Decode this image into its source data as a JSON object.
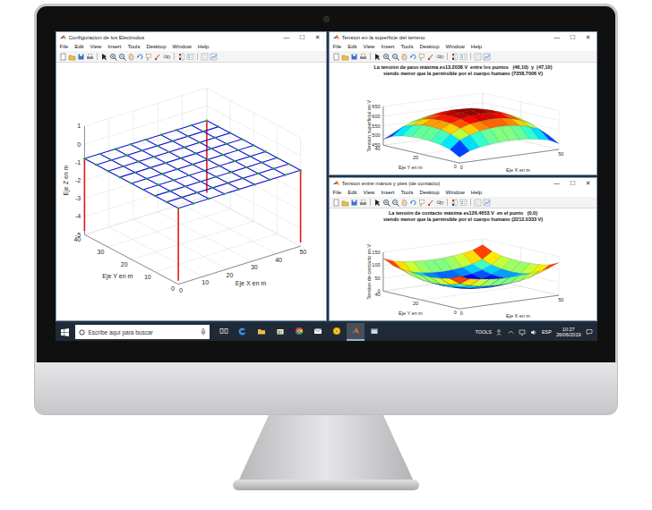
{
  "window_controls": [
    "—",
    "☐",
    "✕"
  ],
  "menu": [
    "File",
    "Edit",
    "View",
    "Insert",
    "Tools",
    "Desktop",
    "Window",
    "Help"
  ],
  "electrode_figure": {
    "window_title": "Configuracion de los Electrodos",
    "x_label": "Eje X en m",
    "y_label": "Eje Y en m",
    "z_label": "Eje Z en m",
    "x_ticks": [
      "0",
      "10",
      "20",
      "30",
      "40",
      "50"
    ],
    "y_ticks": [
      "0",
      "10",
      "20",
      "30",
      "40"
    ],
    "z_ticks": [
      "-5",
      "-4",
      "-3",
      "-2",
      "-1",
      "0",
      "1"
    ],
    "grid_x": [
      0,
      6.25,
      12.5,
      18.75,
      25,
      31.25,
      37.5,
      43.75,
      50
    ],
    "grid_y": [
      0,
      5,
      10,
      15,
      20,
      25,
      30,
      35,
      40
    ],
    "grid_depth": -0.8,
    "rods": [
      {
        "x": 0,
        "y": 0,
        "bottom": -4.8
      },
      {
        "x": 50,
        "y": 0,
        "bottom": -4.8
      },
      {
        "x": 0,
        "y": 40,
        "bottom": -4.8
      },
      {
        "x": 50,
        "y": 40,
        "bottom": -4.8
      }
    ]
  },
  "surface_figure": {
    "window_title": "Tension en la superficie del terreno",
    "title_lines": [
      "La tensión de paso máxima es13.2038 V  entre los puntos   (46,10)  y  (47,10)",
      "siendo menor que la permisible por el cuerpo humano (7358.7006 V)"
    ],
    "x_label": "Eje X en m",
    "y_label": "Eje Y en m",
    "z_label": "Tension superficial en V",
    "x_ticks": [
      "0",
      "50"
    ],
    "y_ticks": [
      "0",
      "20",
      "40"
    ],
    "z_ticks": [
      "450",
      "500",
      "550",
      "600",
      "650"
    ],
    "x_values": [
      0,
      5,
      10,
      15,
      20,
      25,
      30,
      35,
      40,
      45,
      50
    ],
    "y_values": [
      0,
      5,
      10,
      15,
      20,
      25,
      30,
      35,
      40
    ],
    "values": [
      [
        480,
        505,
        516,
        524,
        529,
        530,
        529,
        524,
        516,
        505,
        480
      ],
      [
        508,
        549,
        569,
        582,
        589,
        592,
        589,
        582,
        569,
        549,
        508
      ],
      [
        521,
        569,
        592,
        608,
        616,
        619,
        616,
        608,
        592,
        569,
        521
      ],
      [
        528,
        581,
        606,
        622,
        632,
        635,
        632,
        622,
        606,
        581,
        528
      ],
      [
        530,
        584,
        610,
        627,
        637,
        640,
        637,
        627,
        610,
        584,
        530
      ],
      [
        528,
        581,
        606,
        622,
        632,
        635,
        632,
        622,
        606,
        581,
        528
      ],
      [
        521,
        569,
        592,
        608,
        616,
        619,
        616,
        608,
        592,
        569,
        521
      ],
      [
        508,
        549,
        569,
        582,
        589,
        592,
        589,
        582,
        569,
        549,
        508
      ],
      [
        480,
        505,
        516,
        524,
        529,
        530,
        529,
        524,
        516,
        505,
        480
      ]
    ]
  },
  "contact_figure": {
    "window_title": "Tension entre manos y pies (de contacto)",
    "title_lines": [
      "La tensión de contacto máxima es126.4653 V  en el punto   (0,0)",
      "siendo menor que la permisible por el cuerpo humano (2212.0333 V)"
    ],
    "x_label": "Eje X en m",
    "y_label": "Eje Y en m",
    "z_label": "Tension de contacto en V",
    "x_ticks": [
      "0",
      "50"
    ],
    "y_ticks": [
      "0",
      "20",
      "40"
    ],
    "z_ticks": [
      "0",
      "50",
      "100",
      "150"
    ],
    "x_values": [
      0,
      5,
      10,
      15,
      20,
      25,
      30,
      35,
      40,
      45,
      50
    ],
    "y_values": [
      0,
      5,
      10,
      15,
      20,
      25,
      30,
      35,
      40
    ],
    "values": [
      [
        126.5,
        111,
        104,
        99,
        96,
        95,
        96,
        99,
        104,
        111,
        126.5
      ],
      [
        109,
        84,
        71,
        63,
        59,
        57,
        59,
        63,
        71,
        84,
        109
      ],
      [
        101,
        71,
        57,
        47,
        42,
        40,
        42,
        47,
        57,
        71,
        101
      ],
      [
        97,
        64,
        48,
        38,
        32,
        30,
        32,
        38,
        48,
        64,
        97
      ],
      [
        95,
        62,
        46,
        35,
        29,
        27,
        29,
        35,
        46,
        62,
        95
      ],
      [
        97,
        64,
        48,
        38,
        32,
        30,
        32,
        38,
        48,
        64,
        97
      ],
      [
        101,
        71,
        57,
        47,
        42,
        40,
        42,
        47,
        57,
        71,
        101
      ],
      [
        109,
        84,
        71,
        63,
        59,
        57,
        59,
        63,
        71,
        84,
        109
      ],
      [
        126.5,
        111,
        104,
        99,
        96,
        95,
        96,
        99,
        104,
        111,
        126.5
      ]
    ]
  },
  "taskbar": {
    "search_placeholder": "Escribe aquí para buscar",
    "apps": [
      {
        "kind": "task-view",
        "active": false
      },
      {
        "kind": "edge",
        "active": false
      },
      {
        "kind": "explorer",
        "active": false
      },
      {
        "kind": "store",
        "active": false
      },
      {
        "kind": "chrome",
        "active": false
      },
      {
        "kind": "mail",
        "active": false
      },
      {
        "kind": "chrome-canary",
        "active": false
      },
      {
        "kind": "matlab",
        "active": true
      },
      {
        "kind": "other",
        "active": false
      }
    ],
    "tray_label": "TOOLS",
    "language": "ESP",
    "time": "10:27",
    "date": "26/06/2019"
  }
}
